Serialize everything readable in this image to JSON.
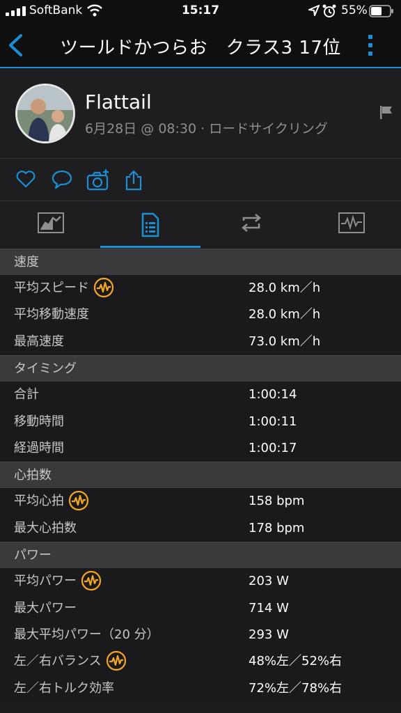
{
  "status_bar": {
    "carrier": "SoftBank",
    "time": "15:17",
    "battery": "55%"
  },
  "nav": {
    "title": "ツールドかつらお　クラス3 17位"
  },
  "profile": {
    "name": "Flattail",
    "meta": "6月28日 @ 08:30 · ロードサイクリング"
  },
  "colors": {
    "accent": "#1b8fd6",
    "badge": "#f5a623"
  },
  "sections": [
    {
      "title": "速度",
      "rows": [
        {
          "label": "平均スピード",
          "value": "28.0 km／h",
          "badge": true
        },
        {
          "label": "平均移動速度",
          "value": "28.0 km／h",
          "badge": false
        },
        {
          "label": "最高速度",
          "value": "73.0 km／h",
          "badge": false
        }
      ]
    },
    {
      "title": "タイミング",
      "rows": [
        {
          "label": "合計",
          "value": "1:00:14",
          "badge": false
        },
        {
          "label": "移動時間",
          "value": "1:00:11",
          "badge": false
        },
        {
          "label": "経過時間",
          "value": "1:00:17",
          "badge": false
        }
      ]
    },
    {
      "title": "心拍数",
      "rows": [
        {
          "label": "平均心拍",
          "value": "158 bpm",
          "badge": true
        },
        {
          "label": "最大心拍数",
          "value": "178 bpm",
          "badge": false
        }
      ]
    },
    {
      "title": "パワー",
      "rows": [
        {
          "label": "平均パワー",
          "value": "203 W",
          "badge": true
        },
        {
          "label": "最大パワー",
          "value": "714 W",
          "badge": false
        },
        {
          "label": "最大平均パワー（20 分）",
          "value": "293 W",
          "badge": false
        },
        {
          "label": "左／右バランス",
          "value": "48%左／52%右",
          "badge": true
        },
        {
          "label": "左／右トルク効率",
          "value": "72%左／78%右",
          "badge": false
        }
      ]
    }
  ]
}
